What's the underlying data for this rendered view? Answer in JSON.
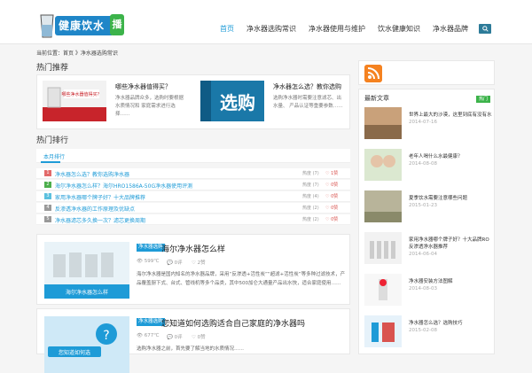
{
  "site": {
    "nav": [
      {
        "label": "首页",
        "active": true
      },
      {
        "label": "净水器选购常识",
        "active": false
      },
      {
        "label": "净水器使用与维护",
        "active": false
      },
      {
        "label": "饮水健康知识",
        "active": false
      },
      {
        "label": "净水器品牌",
        "active": false
      }
    ],
    "logo_text": "健康饮水",
    "logo_badge": "播"
  },
  "breadcrumb": "当前位置：首页 》净水器选购常识",
  "hot": {
    "title": "热门推荐",
    "items": [
      {
        "title": "哪些净水器值得买？",
        "desc": "净水器品牌众多，选购时要根据水质情况和 家庭需求进行选择……",
        "img_text": "哪些净水器值得买？"
      },
      {
        "title": "净水器怎么选？教你选购",
        "desc": "选购净水器时需要注意滤芯、出水量、 产品认证等重要参数……",
        "img_text": "选购"
      }
    ]
  },
  "ranking": {
    "title": "热门排行",
    "tab": "本月排行",
    "items": [
      {
        "num": "1",
        "title": "净水器怎么选？教你选购净水器",
        "count": "热度 (7)",
        "likes": "♡ 1赞"
      },
      {
        "num": "2",
        "title": "海尔净水器怎么样？海尔HRO1586A-50G净水器使用评测",
        "count": "热度 (7)",
        "likes": "♡ 0赞"
      },
      {
        "num": "3",
        "title": "家用净水器哪个牌子好？十大品牌推荐",
        "count": "热度 (4)",
        "likes": "♡ 0赞"
      },
      {
        "num": "4",
        "title": "反渗透净水器的工作原理及优缺点",
        "count": "热度 (2)",
        "likes": "♡ 0赞"
      },
      {
        "num": "5",
        "title": "净水器滤芯多久换一次？滤芯更换周期",
        "count": "热度 (2)",
        "likes": "♡ 0赞"
      }
    ]
  },
  "posts": [
    {
      "tag": "净水器选购",
      "title": "海尔净水器怎么样",
      "views": "👁 599℃",
      "comments": "💬 0评",
      "likes": "♡ 2赞",
      "excerpt": "海尔净水器是国内知名的净水器品牌，采用“反渗透+活性炭”“超滤+活性炭”等多种过滤技术，产品覆盖厨下式、台式、管线机等多个品类，其中500加仑大通量产品出水快，适合家庭使用……",
      "img_caption": "海尔净水器怎么样"
    },
    {
      "tag": "净水器选购",
      "title": "您知道如何选购适合自己家庭的净水器吗",
      "views": "👁 677℃",
      "comments": "💬 0评",
      "likes": "♡ 0赞",
      "excerpt": "选购净水器之前，首先要了解当地的水质情况……",
      "img_caption": "您知道如何选"
    }
  ],
  "sidebar": {
    "title": "最新文章",
    "badge": "热门",
    "items": [
      {
        "title": "世界上最大的沙漠，这里到底有没有水",
        "date": "2014-07-16"
      },
      {
        "title": "老年人喝什么水最健康？",
        "date": "2014-08-08"
      },
      {
        "title": "夏季饮水需要注意哪些问题",
        "date": "2015-01-23"
      },
      {
        "title": "家用净水器哪个牌子好？十大品牌RO反渗透净水器推荐",
        "date": "2014-06-04"
      },
      {
        "title": "净水器安装方法图解",
        "date": "2014-08-03"
      },
      {
        "title": "净水器怎么选？选购技巧",
        "date": "2015-02-08"
      }
    ]
  },
  "colors": {
    "accent": "#1e9bd7",
    "green": "#3cb34a",
    "red": "#d9534f",
    "orange": "#f58220"
  }
}
